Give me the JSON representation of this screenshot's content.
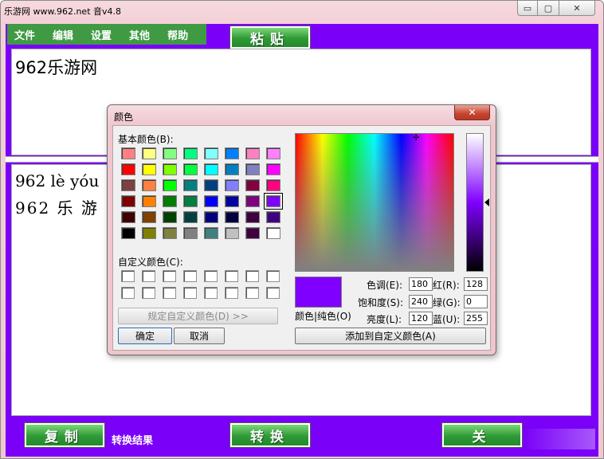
{
  "window": {
    "title": "乐游网 www.962.net 音v4.8",
    "min_symbol": "▭",
    "max_symbol": "▢",
    "close_symbol": "✕",
    "accent_color": "#7a00f8",
    "button_color": "#2f9a36"
  },
  "menu": [
    {
      "label": "文件"
    },
    {
      "label": "编辑"
    },
    {
      "label": "设置"
    },
    {
      "label": "其他"
    },
    {
      "label": "帮助"
    }
  ],
  "toolbar": {
    "paste_label": "粘贴"
  },
  "input": {
    "text": "962乐游网"
  },
  "output": {
    "line1": "962 lè yóu",
    "line2": "962 乐 游"
  },
  "footer": {
    "copy_label": "复制",
    "result_label": "转换结果",
    "convert_label": "转换",
    "close_label": "关"
  },
  "dialog": {
    "title": "颜色",
    "close_symbol": "✕",
    "basic_colors_label": "基本颜色(B):",
    "custom_colors_label": "自定义颜色(C):",
    "define_custom_label": "规定自定义颜色(D) >>",
    "ok_label": "确定",
    "cancel_label": "取消",
    "add_custom_label": "添加到自定义颜色(A)",
    "preview_label": "颜色|纯色(O)",
    "hue_label": "色调(E):",
    "sat_label": "饱和度(S):",
    "lum_label": "亮度(L):",
    "red_label": "红(R):",
    "green_label": "绿(G):",
    "blue_label": "蓝(U):",
    "hue": "180",
    "sat": "240",
    "lum": "120",
    "red": "128",
    "green": "0",
    "blue": "255",
    "current_color": "#8000ff",
    "basic_colors": [
      [
        "#ff8080",
        "#ffff80",
        "#80ff80",
        "#00ff80",
        "#80ffff",
        "#0080ff",
        "#ff80c0",
        "#ff80ff"
      ],
      [
        "#ff0000",
        "#ffff00",
        "#80ff00",
        "#00ff40",
        "#00ffff",
        "#0080c0",
        "#8080c0",
        "#ff00ff"
      ],
      [
        "#804040",
        "#ff8040",
        "#00ff00",
        "#008080",
        "#004080",
        "#8080ff",
        "#800040",
        "#ff0080"
      ],
      [
        "#800000",
        "#ff8000",
        "#008000",
        "#008040",
        "#0000ff",
        "#0000a0",
        "#800080",
        "#8000ff"
      ],
      [
        "#400000",
        "#804000",
        "#004000",
        "#004040",
        "#000080",
        "#000040",
        "#400040",
        "#400080"
      ],
      [
        "#000000",
        "#808000",
        "#808040",
        "#808080",
        "#408080",
        "#c0c0c0",
        "#400040",
        "#ffffff"
      ]
    ],
    "selected_swatch": {
      "row": 3,
      "col": 7
    }
  }
}
